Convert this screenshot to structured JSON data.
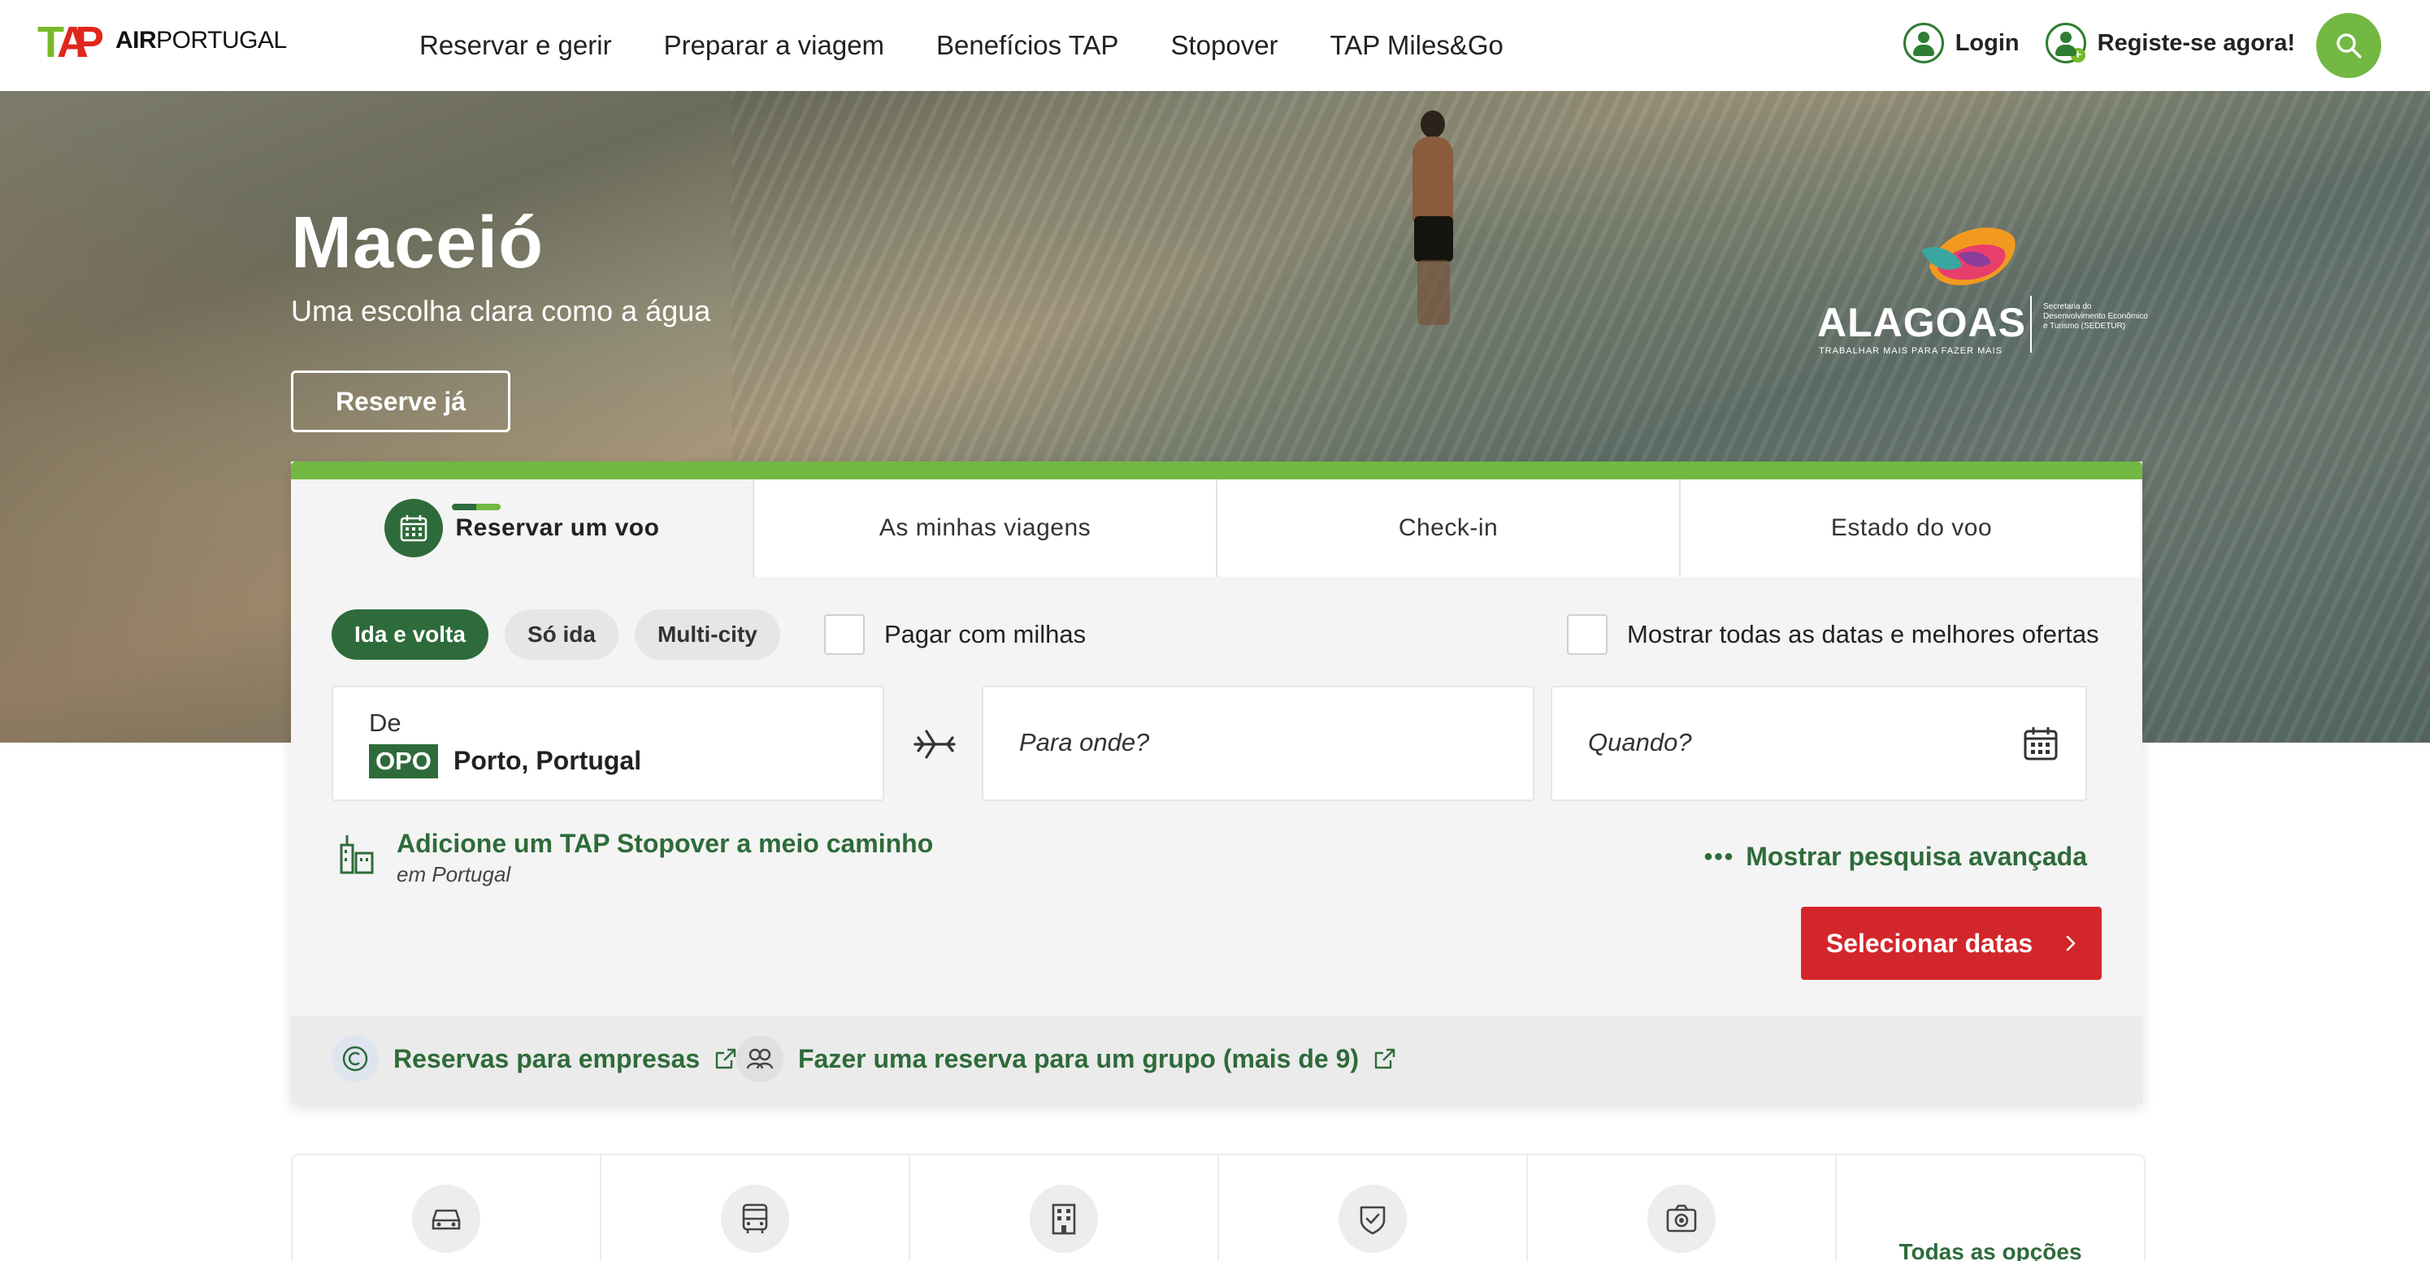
{
  "header": {
    "logo_mark": "TAP",
    "logo_air": "AIR",
    "logo_portugal": "PORTUGAL",
    "nav": [
      {
        "label": "Reservar e gerir"
      },
      {
        "label": "Preparar a viagem"
      },
      {
        "label": "Benefícios TAP"
      },
      {
        "label": "Stopover"
      },
      {
        "label": "TAP Miles&Go"
      }
    ],
    "login_label": "Login",
    "register_label": "Registe-se agora!"
  },
  "hero": {
    "title": "Maceió",
    "subtitle": "Uma escolha clara como a água",
    "cta_label": "Reserve já",
    "partner_logo": {
      "name": "ALAGOAS",
      "tagline": "TRABALHAR MAIS PARA FAZER MAIS",
      "secretariat": "Secretaria do Desenvolvimento Econômico e Turismo (SEDETUR)"
    },
    "carousel_slides": 5,
    "carousel_active": 3
  },
  "booking": {
    "tabs": [
      {
        "label": "Reservar um voo",
        "active": true
      },
      {
        "label": "As minhas viagens",
        "active": false
      },
      {
        "label": "Check-in",
        "active": false
      },
      {
        "label": "Estado do voo",
        "active": false
      }
    ],
    "trip_types": [
      {
        "label": "Ida e volta",
        "active": true
      },
      {
        "label": "Só ida",
        "active": false
      },
      {
        "label": "Multi-city",
        "active": false
      }
    ],
    "pay_with_miles_label": "Pagar com milhas",
    "show_all_dates_label": "Mostrar todas as datas e melhores ofertas",
    "from": {
      "label": "De",
      "code": "OPO",
      "city": "Porto, Portugal"
    },
    "to_placeholder": "Para onde?",
    "when_placeholder": "Quando?",
    "stopover_title": "Adicione um TAP Stopover a meio caminho",
    "stopover_subtitle": "em Portugal",
    "advanced_search_label": "Mostrar pesquisa avançada",
    "submit_label": "Selecionar datas",
    "footer": {
      "business_label": "Reservas para empresas",
      "group_label": "Fazer uma reserva para um grupo (mais de 9)"
    }
  },
  "options": {
    "items": [
      {
        "icon": "car-icon"
      },
      {
        "icon": "bus-icon"
      },
      {
        "icon": "hotel-icon"
      },
      {
        "icon": "insurance-icon"
      },
      {
        "icon": "camera-icon"
      }
    ],
    "all_label": "Todas as opções de reserva"
  },
  "colors": {
    "brand_green": "#2e6b3a",
    "accent_green": "#72b843",
    "cta_red": "#d3262b",
    "logo_red": "#e1261c"
  }
}
